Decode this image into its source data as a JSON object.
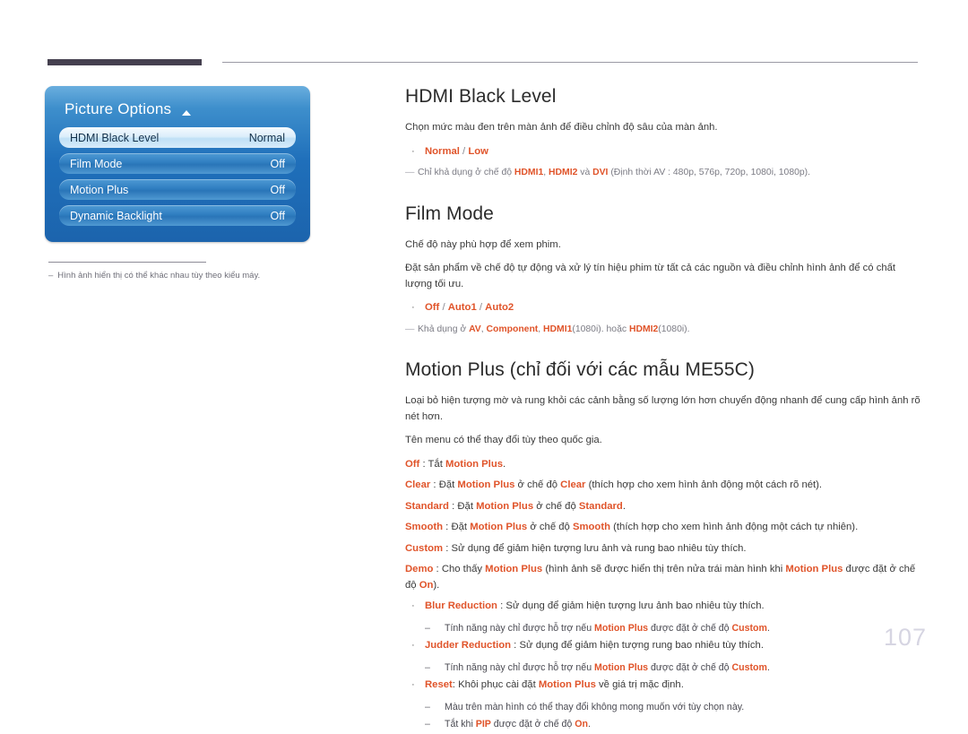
{
  "colors": {
    "accent_orange": "#e0542a",
    "rule_dark": "#45404f",
    "page_number": "#d6d5e2",
    "osd_blue": "#1f6fba"
  },
  "osd": {
    "title": "Picture Options",
    "arrow_icon": "caret-up-icon",
    "rows": [
      {
        "label": "HDMI Black Level",
        "value": "Normal",
        "selected": true
      },
      {
        "label": "Film Mode",
        "value": "Off",
        "selected": false
      },
      {
        "label": "Motion Plus",
        "value": "Off",
        "selected": false
      },
      {
        "label": "Dynamic Backlight",
        "value": "Off",
        "selected": false
      }
    ]
  },
  "left_note": {
    "dash": "–",
    "text": "Hình ảnh hiển thị có thể khác nhau tùy theo kiểu máy."
  },
  "sections": {
    "hdmi_black_level": {
      "title": "HDMI Black Level",
      "intro": "Chọn mức màu đen trên màn ảnh để điều chỉnh độ sâu của màn ảnh.",
      "bullet_marker": "·",
      "options": {
        "a": "Normal",
        "sep": " / ",
        "b": "Low"
      },
      "footnote": {
        "marker": "—",
        "pre": "Chỉ khả dụng ở chế độ ",
        "k1": "HDMI1",
        "mid1": ", ",
        "k2": "HDMI2",
        "mid2": " và ",
        "k3": "DVI",
        "post": " (Định thời AV : 480p, 576p, 720p, 1080i, 1080p)."
      }
    },
    "film_mode": {
      "title": "Film Mode",
      "para1": "Chế độ này phù hợp để xem phim.",
      "para2": "Đặt sản phẩm về chế độ tự động và xử lý tín hiệu phim từ tất cả các nguồn và điều chỉnh hình ảnh để có chất lượng tối ưu.",
      "bullet_marker": "·",
      "options": {
        "a": "Off",
        "sep1": " / ",
        "b": "Auto1",
        "sep2": " / ",
        "c": "Auto2"
      },
      "footnote": {
        "marker": "—",
        "pre": "Khả dụng ở ",
        "k1": "AV",
        "mid1": ", ",
        "k2": "Component",
        "mid2": ", ",
        "k3": "HDMI1",
        "sub1": "(1080i)",
        "mid3": ". hoặc ",
        "k4": "HDMI2",
        "sub2": "(1080i)",
        "post": "."
      }
    },
    "motion_plus": {
      "title": "Motion Plus (chỉ đối với các mẫu ME55C)",
      "para1": "Loại bỏ hiện tượng mờ và rung khỏi các cảnh bằng số lượng lớn hơn chuyển động nhanh để cung cấp hình ảnh rõ nét hơn.",
      "para2": "Tên menu có thể thay đổi tùy theo quốc gia.",
      "deflines": [
        {
          "key": "Off",
          "sep": " : ",
          "t1": "Tắt ",
          "k2": "Motion Plus",
          "t2": "."
        },
        {
          "key": "Clear",
          "sep": " : ",
          "t1": "Đặt ",
          "k2": "Motion Plus",
          "t2": " ở chế độ ",
          "k3": "Clear",
          "t3": " (thích hợp cho xem hình ảnh động một cách rõ nét)."
        },
        {
          "key": "Standard",
          "sep": " : ",
          "t1": "Đặt ",
          "k2": "Motion Plus",
          "t2": " ở chế độ ",
          "k3": "Standard",
          "t3": "."
        },
        {
          "key": "Smooth",
          "sep": " : ",
          "t1": "Đặt ",
          "k2": "Motion Plus",
          "t2": " ở chế độ ",
          "k3": "Smooth",
          "t3": " (thích hợp cho xem hình ảnh động một cách tự nhiên)."
        },
        {
          "key": "Custom",
          "sep": " : ",
          "t1": "Sử dụng để giảm hiện tượng lưu ảnh và rung bao nhiêu tùy thích."
        },
        {
          "key": "Demo",
          "sep": " : ",
          "t1": "Cho thấy ",
          "k2": "Motion Plus",
          "t2": " (hình ảnh sẽ được hiển thị trên nửa trái màn hình khi ",
          "k3": "Motion Plus",
          "t3": " được đặt ở chế độ ",
          "k4": "On",
          "t4": ")."
        }
      ],
      "bullet_marker": "·",
      "dash_marker": "–",
      "bullets": [
        {
          "key": "Blur Reduction",
          "sep": " : ",
          "text": "Sử dụng để giảm hiện tượng lưu ảnh bao nhiêu tùy thích.",
          "sub": [
            {
              "pre": "Tính năng này chỉ được hỗ trợ nếu ",
              "k1": "Motion Plus",
              "mid": " được đặt ở chế độ ",
              "k2": "Custom",
              "post": "."
            }
          ]
        },
        {
          "key": "Judder Reduction",
          "sep": " : ",
          "text": "Sử dụng để giảm hiện tượng rung bao nhiêu tùy thích.",
          "sub": [
            {
              "pre": "Tính năng này chỉ được hỗ trợ nếu ",
              "k1": "Motion Plus",
              "mid": " được đặt ở chế độ ",
              "k2": "Custom",
              "post": "."
            }
          ]
        },
        {
          "key": "Reset",
          "sep": ": ",
          "pre_text": "Khôi phục cài đặt ",
          "k_inline": "Motion Plus",
          "post_text": " về giá trị mặc định.",
          "sub": [
            {
              "pre": "Màu trên màn hình có thể thay đổi không mong muốn với tùy chọn này."
            },
            {
              "pre": "Tắt khi ",
              "k1": "PIP",
              "mid": " được đặt ở chế độ ",
              "k2": "On",
              "post": "."
            }
          ]
        }
      ]
    }
  },
  "page_number": "107"
}
